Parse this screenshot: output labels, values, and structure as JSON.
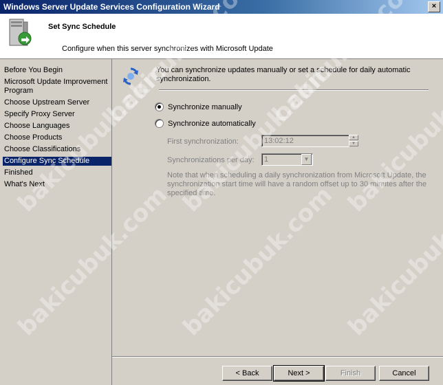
{
  "window": {
    "title": "Windows Server Update Services Configuration Wizard",
    "close_label": "×"
  },
  "header": {
    "title": "Set Sync Schedule",
    "subtitle": "Configure when this server synchronizes with Microsoft Update"
  },
  "nav": {
    "items": [
      {
        "label": "Before You Begin"
      },
      {
        "label": "Microsoft Update Improvement"
      },
      {
        "label": "Program"
      },
      {
        "label": "Choose Upstream Server"
      },
      {
        "label": "Specify Proxy Server"
      },
      {
        "label": "Choose Languages"
      },
      {
        "label": "Choose Products"
      },
      {
        "label": "Choose Classifications"
      },
      {
        "label": "Configure Sync Schedule",
        "active": true
      },
      {
        "label": "Finished"
      },
      {
        "label": "What's Next"
      }
    ]
  },
  "content": {
    "intro": "You can synchronize updates manually or set a schedule for daily automatic synchronization.",
    "option_manual": "Synchronize manually",
    "option_auto": "Synchronize automatically",
    "selected_option": "manual",
    "first_sync_label": "First synchronization:",
    "first_sync_value": "13:02:12",
    "per_day_label": "Synchronizations per day:",
    "per_day_value": "1",
    "note": "Note that when scheduling a daily synchronization from Microsoft Update, the synchronization start time will have a random offset up to 30 minutes after the specified time."
  },
  "buttons": {
    "back": "< Back",
    "next": "Next >",
    "finish": "Finish",
    "cancel": "Cancel"
  },
  "watermark": "bakicubuk.com"
}
